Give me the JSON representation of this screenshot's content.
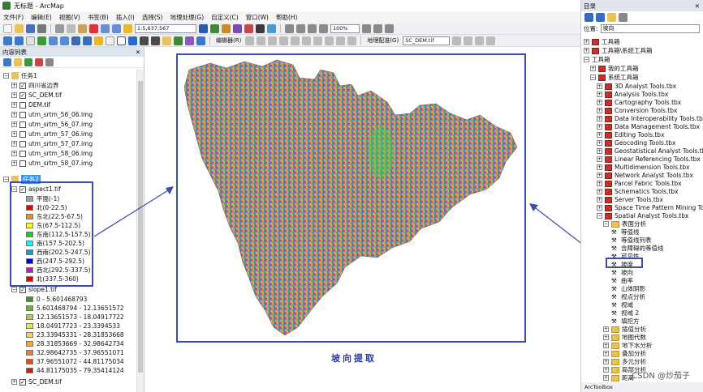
{
  "window": {
    "title": "无标题 - ArcMap"
  },
  "menu": [
    "文件(F)",
    "编辑(E)",
    "视图(V)",
    "书签(B)",
    "插入(I)",
    "选择(S)",
    "地理处理(G)",
    "自定义(C)",
    "窗口(W)",
    "帮助(H)"
  ],
  "toolbar": {
    "scale": "1:5,637,567",
    "zoom": "100%",
    "editor_label": "编辑器(R)",
    "georef_label": "地理配准(G)",
    "georef_layer": "SC_DEM.tif"
  },
  "toc": {
    "title": "内容列表",
    "group1": {
      "name": "任务1",
      "layers": [
        "四川省边界",
        "SC_DEM.tif",
        "DEM.tif",
        "utm_srtm_56_06.img",
        "utm_srtm_56_07.img",
        "utm_srtm_57_06.img",
        "utm_srtm_57_07.img",
        "utm_srtm_58_06.img",
        "utm_srtm_58_07.img"
      ]
    },
    "group2": {
      "name": "任务2",
      "aspect": {
        "name": "aspect1.tif",
        "classes": [
          {
            "label": "平面(-1)",
            "color": "#9e9e9e"
          },
          {
            "label": "北(0-22.5)",
            "color": "#e00000"
          },
          {
            "label": "东北(22.5-67.5)",
            "color": "#ff8c00"
          },
          {
            "label": "东(67.5-112.5)",
            "color": "#ffff00"
          },
          {
            "label": "东南(112.5-157.5)",
            "color": "#00e000"
          },
          {
            "label": "南(157.5-202.5)",
            "color": "#00ffff"
          },
          {
            "label": "西南(202.5-247.5)",
            "color": "#00a0e0"
          },
          {
            "label": "西(247.5-292.5)",
            "color": "#0000e0"
          },
          {
            "label": "西北(292.5-337.5)",
            "color": "#e000e0"
          },
          {
            "label": "北(337.5-360)",
            "color": "#e00000"
          }
        ]
      },
      "slope": {
        "name": "slope1.tif",
        "classes": [
          {
            "label": "0 - 5.601468793",
            "color": "#3a9a1a"
          },
          {
            "label": "5.601468794 - 12.13651572",
            "color": "#6ab82a"
          },
          {
            "label": "12.13651573 - 18.04917722",
            "color": "#a8d43a"
          },
          {
            "label": "18.04917723 - 23.3394533",
            "color": "#e8e84a"
          },
          {
            "label": "23.33945331 - 28.31853668",
            "color": "#ffd23a"
          },
          {
            "label": "28.31853669 - 32.98642734",
            "color": "#ffa52a"
          },
          {
            "label": "32.98642735 - 37.96551071",
            "color": "#ff781a"
          },
          {
            "label": "37.96551072 - 44.81175034",
            "color": "#f04a10"
          },
          {
            "label": "44.81175035 - 79.35414124",
            "color": "#d81e08"
          }
        ]
      },
      "extra": "SC_DEM.tif"
    }
  },
  "map": {
    "caption": "坡向提取"
  },
  "catalog": {
    "title": "目录",
    "location_label": "位置:",
    "location_value": "坡向",
    "top_items": [
      "工具箱",
      "工具箱\\系统工具箱"
    ],
    "root": "工具箱",
    "my_toolbox": "我的工具箱",
    "system_toolbox": "系统工具箱",
    "toolboxes": [
      "3D Analyst Tools.tbx",
      "Analysis Tools.tbx",
      "Cartography Tools.tbx",
      "Conversion Tools.tbx",
      "Data Interoperability Tools.tbx",
      "Data Management Tools.tbx",
      "Editing Tools.tbx",
      "Geocoding Tools.tbx",
      "Geostatistical Analyst Tools.tbx",
      "Linear Referencing Tools.tbx",
      "Multidimension Tools.tbx",
      "Network Analyst Tools.tbx",
      "Parcel Fabric Tools.tbx",
      "Schematics Tools.tbx",
      "Server Tools.tbx",
      "Space Time Pattern Mining Tools.p",
      "Spatial Analyst Tools.tbx"
    ],
    "surface_folder": "表面分析",
    "surface_tools": [
      "等值线",
      "等值线列表",
      "含障碍的等值线",
      "可见性",
      "坡度",
      "坡向",
      "曲率",
      "山体阴影",
      "视点分析",
      "视域",
      "视域 2",
      "填挖方"
    ],
    "other_folders": [
      "插值分析",
      "地图代数",
      "地下水分析",
      "叠加分析",
      "多元分析",
      "局部分析",
      "距离"
    ],
    "footer": "ArcToolbox"
  },
  "watermark": "CSDN @炒茄子"
}
